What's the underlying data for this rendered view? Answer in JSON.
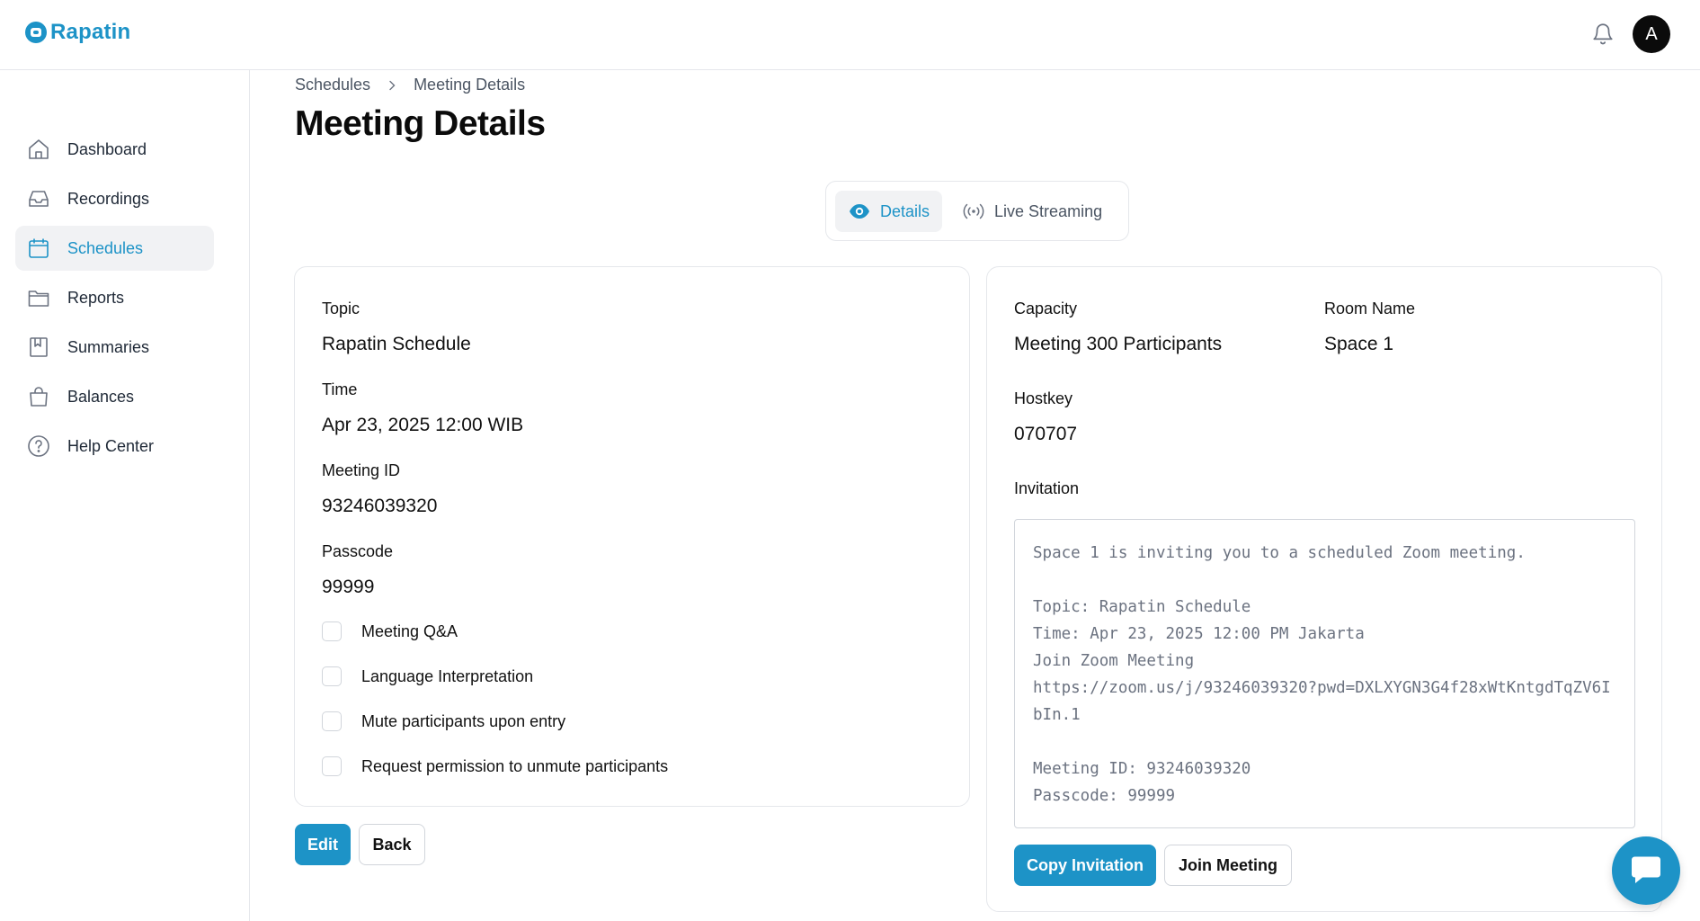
{
  "app": {
    "name": "Rapatin"
  },
  "header": {
    "avatar_initial": "A",
    "icons": [
      "bell-icon"
    ]
  },
  "sidebar": {
    "items": [
      {
        "label": "Dashboard",
        "icon": "home-icon",
        "active": false
      },
      {
        "label": "Recordings",
        "icon": "inbox-icon",
        "active": false
      },
      {
        "label": "Schedules",
        "icon": "calendar-icon",
        "active": true
      },
      {
        "label": "Reports",
        "icon": "folder-icon",
        "active": false
      },
      {
        "label": "Summaries",
        "icon": "bookmark-icon",
        "active": false
      },
      {
        "label": "Balances",
        "icon": "shopping-bag-icon",
        "active": false
      },
      {
        "label": "Help Center",
        "icon": "help-circle-icon",
        "active": false
      }
    ]
  },
  "breadcrumb": {
    "parent": "Schedules",
    "current": "Meeting Details"
  },
  "page": {
    "title": "Meeting Details"
  },
  "tabs": [
    {
      "label": "Details",
      "icon": "eye-icon",
      "active": true
    },
    {
      "label": "Live Streaming",
      "icon": "broadcast-icon",
      "active": false
    }
  ],
  "details": {
    "topic_label": "Topic",
    "topic": "Rapatin Schedule",
    "time_label": "Time",
    "time": "Apr 23, 2025 12:00 WIB",
    "meeting_id_label": "Meeting ID",
    "meeting_id": "93246039320",
    "passcode_label": "Passcode",
    "passcode": "99999",
    "options": [
      {
        "label": "Meeting Q&A",
        "checked": false
      },
      {
        "label": "Language Interpretation",
        "checked": false
      },
      {
        "label": "Mute participants upon entry",
        "checked": false
      },
      {
        "label": "Request permission to unmute participants",
        "checked": false
      }
    ]
  },
  "info": {
    "capacity_label": "Capacity",
    "capacity": "Meeting 300 Participants",
    "room_name_label": "Room Name",
    "room_name": "Space 1",
    "hostkey_label": "Hostkey",
    "hostkey": "070707",
    "invitation_label": "Invitation",
    "invitation_text": "Space 1 is inviting you to a scheduled Zoom meeting.\n\nTopic: Rapatin Schedule\nTime: Apr 23, 2025 12:00 PM Jakarta\nJoin Zoom Meeting\nhttps://zoom.us/j/93246039320?pwd=DXLXYGN3G4f28xWtKntgdTqZV6IbIn.1\n\nMeeting ID: 93246039320\nPasscode: 99999"
  },
  "actions": {
    "edit_label": "Edit",
    "back_label": "Back",
    "copy_invitation_label": "Copy Invitation",
    "join_meeting_label": "Join Meeting"
  },
  "colors": {
    "accent": "#1d93c7",
    "border": "#e5e7eb",
    "active_bg": "#f1f2f4"
  }
}
